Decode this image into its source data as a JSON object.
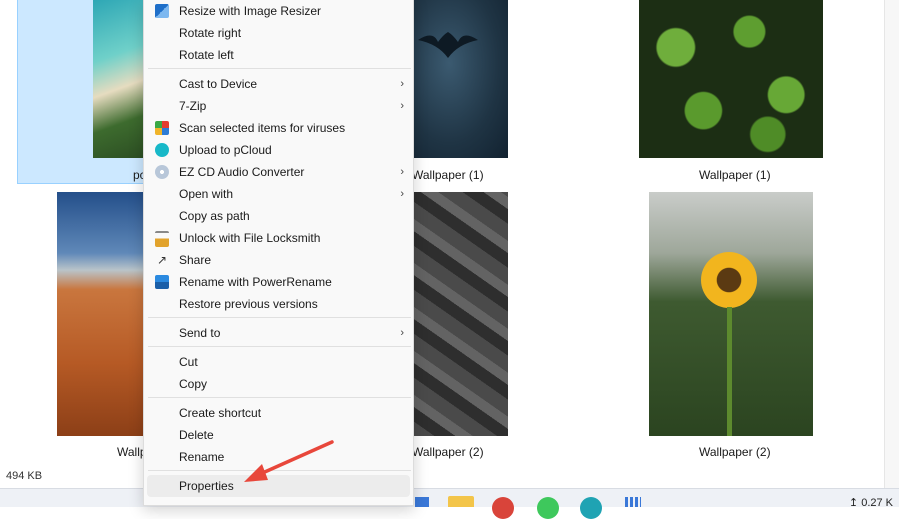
{
  "menu": {
    "items": [
      {
        "label": "Resize with Image Resizer",
        "icon": "image-resizer-icon",
        "submenu": false
      },
      {
        "label": "Rotate right",
        "icon": "",
        "submenu": false
      },
      {
        "label": "Rotate left",
        "icon": "",
        "submenu": false
      },
      {
        "label": "Cast to Device",
        "icon": "",
        "submenu": true
      },
      {
        "label": "7-Zip",
        "icon": "",
        "submenu": true
      },
      {
        "label": "Scan selected items for viruses",
        "icon": "avg-shield-icon",
        "submenu": false
      },
      {
        "label": "Upload to pCloud",
        "icon": "pcloud-icon",
        "submenu": false
      },
      {
        "label": "EZ CD Audio Converter",
        "icon": "cd-icon",
        "submenu": true
      },
      {
        "label": "Open with",
        "icon": "",
        "submenu": true
      },
      {
        "label": "Copy as path",
        "icon": "",
        "submenu": false
      },
      {
        "label": "Unlock with File Locksmith",
        "icon": "lock-icon",
        "submenu": false
      },
      {
        "label": "Share",
        "icon": "share-icon",
        "submenu": false
      },
      {
        "label": "Rename with PowerRename",
        "icon": "power-rename-icon",
        "submenu": false
      },
      {
        "label": "Restore previous versions",
        "icon": "",
        "submenu": false
      },
      {
        "label": "Send to",
        "icon": "",
        "submenu": true
      },
      {
        "label": "Cut",
        "icon": "",
        "submenu": false
      },
      {
        "label": "Copy",
        "icon": "",
        "submenu": false
      },
      {
        "label": "Create shortcut",
        "icon": "",
        "submenu": false
      },
      {
        "label": "Delete",
        "icon": "",
        "submenu": false
      },
      {
        "label": "Rename",
        "icon": "",
        "submenu": false
      },
      {
        "label": "Properties",
        "icon": "",
        "submenu": false,
        "highlighted": true
      }
    ],
    "chevron": "›"
  },
  "files": [
    {
      "caption": "pc",
      "icon": "beach-thumbnail"
    },
    {
      "caption": "Wallpaper (1)",
      "icon": "batman-thumbnail"
    },
    {
      "caption": "Wallpaper (1)",
      "icon": "leaves-thumbnail"
    },
    {
      "caption": "Wallp",
      "icon": "desert-thumbnail"
    },
    {
      "caption": "Wallpaper (2)",
      "icon": "polygon-thumbnail"
    },
    {
      "caption": "Wallpaper (2)",
      "icon": "sunflower-thumbnail"
    }
  ],
  "status": {
    "size": "494 KB"
  },
  "tray": {
    "text": "↥ 0.27 K"
  },
  "colors": {
    "selection": "#cce8ff",
    "arrow": "#e8473b",
    "menu_bg": "#f9f9f9"
  }
}
